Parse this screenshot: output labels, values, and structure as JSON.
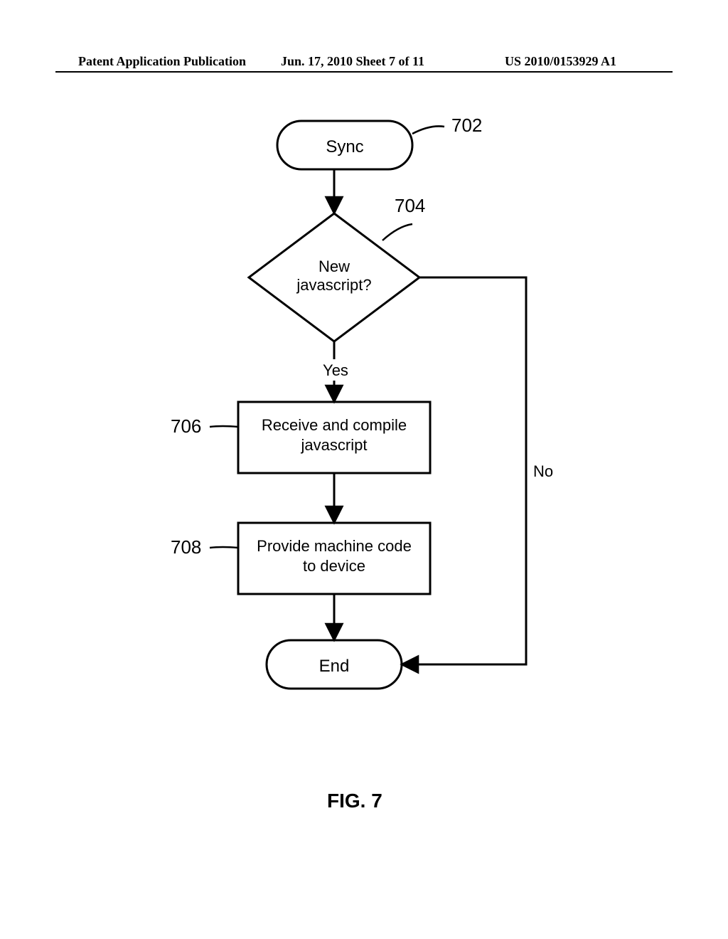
{
  "header": {
    "left": "Patent Application Publication",
    "center": "Jun. 17, 2010  Sheet 7 of 11",
    "right": "US 2010/0153929 A1"
  },
  "diagram": {
    "nodes": {
      "start": {
        "ref": "702",
        "label": "Sync"
      },
      "decision": {
        "ref": "704",
        "line1": "New",
        "line2": "javascript?"
      },
      "proc1": {
        "ref": "706",
        "line1": "Receive and compile",
        "line2": "javascript"
      },
      "proc2": {
        "ref": "708",
        "line1": "Provide machine code",
        "line2": "to device"
      },
      "end": {
        "label": "End"
      }
    },
    "edges": {
      "yes": "Yes",
      "no": "No"
    }
  },
  "figure_caption": "FIG. 7"
}
